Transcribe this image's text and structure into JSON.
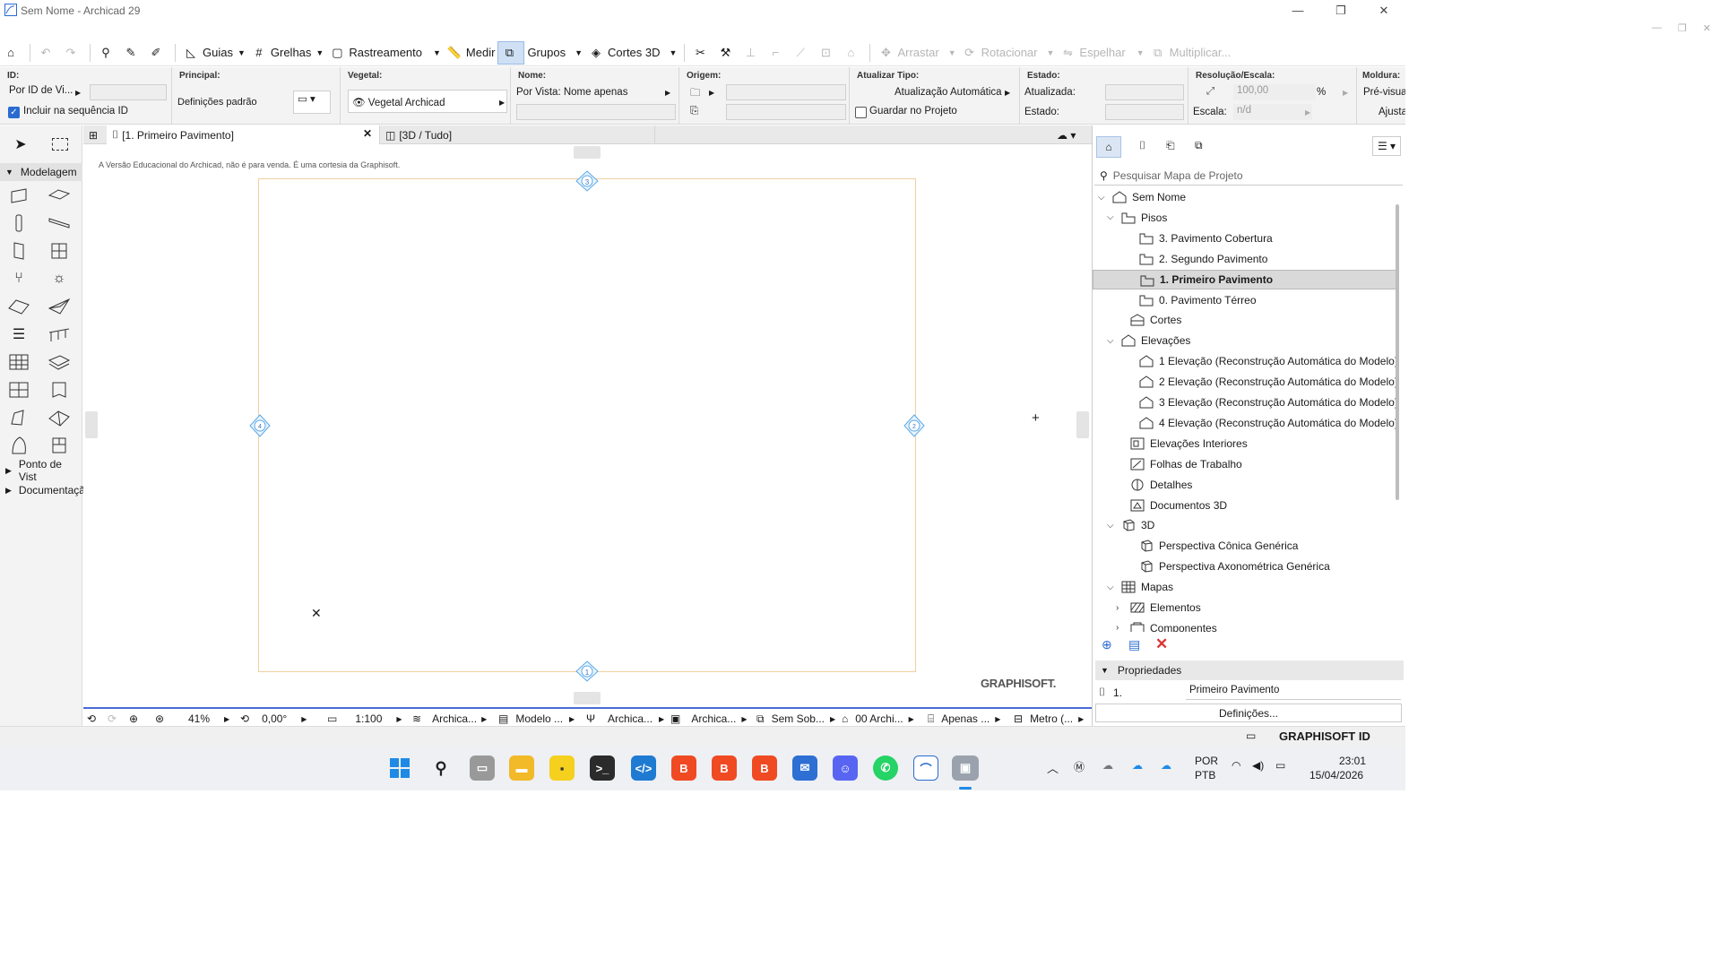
{
  "window": {
    "title": "Sem Nome - Archicad 29"
  },
  "toolbar": {
    "guides": "Guias",
    "grids": "Grelhas",
    "tracking": "Rastreamento",
    "measure": "Medir",
    "groups": "Grupos",
    "sections3d": "Cortes 3D",
    "drag": "Arrastar",
    "rotate": "Rotacionar",
    "mirror": "Espelhar",
    "multiply": "Multiplicar..."
  },
  "infobox": {
    "id_label": "ID:",
    "id_value": "Por ID de Vi...",
    "include_seq": "Incluir na sequência ID",
    "principal_label": "Principal:",
    "principal_value": "Definições padrão",
    "vegetal_label": "Vegetal:",
    "vegetal_value": "Vegetal Archicad",
    "nome_label": "Nome:",
    "nome_value": "Por Vista: Nome apenas",
    "origem_label": "Origem:",
    "atualizar_label": "Atualizar Tipo:",
    "atualizar_value": "Atualização Automática",
    "guardar": "Guardar no Projeto",
    "estado_label": "Estado:",
    "atualizada": "Atualizada:",
    "estado2": "Estado:",
    "resolucao_label": "Resolução/Escala:",
    "res_value": "100,00",
    "res_unit": "%",
    "escala": "Escala:",
    "escala_value": "n/d",
    "moldura_label": "Moldura:",
    "moldura_value": "Pré-visua",
    "ajusta": "Ajusta"
  },
  "toolbox": {
    "modelagem": "Modelagem",
    "ponto_vista": "Ponto de Vist",
    "documentacao": "Documentaçã"
  },
  "tabs": {
    "floor": "[1. Primeiro Pavimento]",
    "view3d": "[3D / Tudo]"
  },
  "canvas": {
    "notice": "A Versão Educacional do Archicad, não é para venda. É uma cortesia da Graphisoft.",
    "watermark": "GRAPHISOFT.",
    "marker_top": "3",
    "marker_bottom": "1",
    "marker_left": "4",
    "marker_right": "2"
  },
  "statusbar": {
    "zoom": "41%",
    "angle": "0,00°",
    "scale": "1:100",
    "layer": "Archica...",
    "model": "Modelo ...",
    "pen": "Archica...",
    "graphic": "Archica...",
    "override": "Sem Sob...",
    "renov": "00 Archi...",
    "struct": "Apenas ...",
    "dim": "Metro (..."
  },
  "navigator": {
    "search_placeholder": "Pesquisar Mapa de Projeto",
    "items": [
      {
        "label": "Sem Nome"
      },
      {
        "label": "Pisos"
      },
      {
        "label": "3. Pavimento Cobertura"
      },
      {
        "label": "2. Segundo Pavimento"
      },
      {
        "label": "1. Primeiro Pavimento"
      },
      {
        "label": "0. Pavimento Térreo"
      },
      {
        "label": "Cortes"
      },
      {
        "label": "Elevações"
      },
      {
        "label": "1 Elevação (Reconstrução Automática do Modelo)"
      },
      {
        "label": "2 Elevação (Reconstrução Automática do Modelo)"
      },
      {
        "label": "3 Elevação (Reconstrução Automática do Modelo)"
      },
      {
        "label": "4 Elevação (Reconstrução Automática do Modelo)"
      },
      {
        "label": "Elevações Interiores"
      },
      {
        "label": "Folhas de Trabalho"
      },
      {
        "label": "Detalhes"
      },
      {
        "label": "Documentos 3D"
      },
      {
        "label": "3D"
      },
      {
        "label": "Perspectiva Cônica Genérica"
      },
      {
        "label": "Perspectiva Axonométrica Genérica"
      },
      {
        "label": "Mapas"
      },
      {
        "label": "Elementos"
      },
      {
        "label": "Componentes"
      }
    ],
    "properties_title": "Propriedades",
    "prop_id": "1.",
    "prop_name": "Primeiro Pavimento",
    "definitions": "Definições..."
  },
  "footer": {
    "graphisoft_id": "GRAPHISOFT ID"
  },
  "taskbar": {
    "lang1": "POR",
    "lang2": "PTB",
    "time": "23:01",
    "date": "15/04/2026"
  },
  "colors": {
    "accent": "#4a6bd6",
    "selection": "#d9d9d9",
    "boundary": "#f2cfa0",
    "marker": "#5aa8e8"
  }
}
